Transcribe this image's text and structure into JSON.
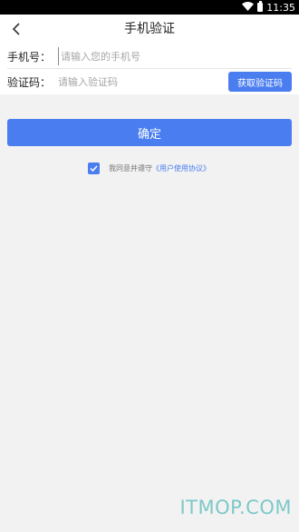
{
  "status_bar": {
    "time": "11:35"
  },
  "header": {
    "title": "手机验证"
  },
  "form": {
    "phone_label": "手机号：",
    "phone_placeholder": "请输入您的手机号",
    "code_label": "验证码：",
    "code_placeholder": "请输入验证码",
    "get_code_label": "获取验证码"
  },
  "confirm_label": "确定",
  "agreement": {
    "checked": true,
    "text": "我同意并遵守",
    "link": "《用户使用协议》"
  },
  "watermark": "ITMOP.COM",
  "colors": {
    "accent": "#4a7ef0",
    "background": "#f2f2f2"
  }
}
